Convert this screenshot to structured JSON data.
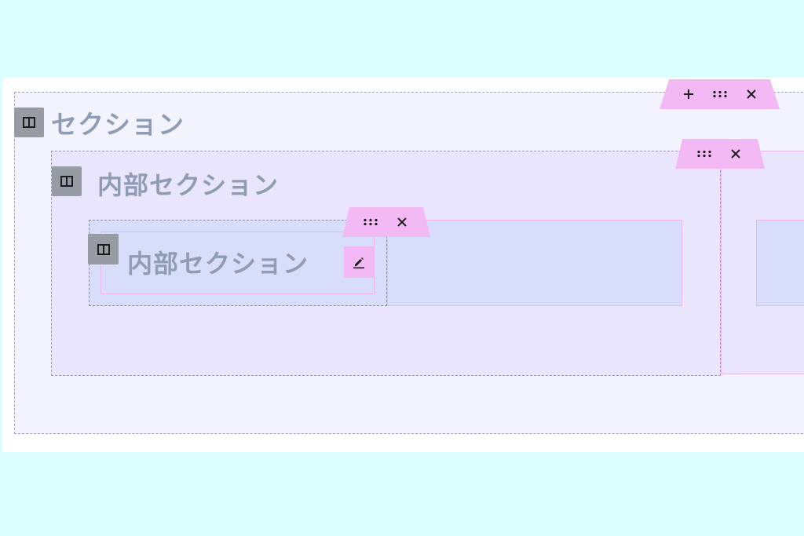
{
  "sections": {
    "outer": {
      "heading": "セクション"
    },
    "inner1": {
      "heading": "内部セクション"
    },
    "inner2": {
      "heading": "内部セクション"
    }
  },
  "icons": {
    "section_type": "columns-icon",
    "add": "plus-icon",
    "drag": "drag-handle-icon",
    "remove": "close-icon",
    "edit": "pencil-icon"
  },
  "colors": {
    "page_background": "#dcfefd",
    "toolbar_accent": "#f2b9f5",
    "heading_text": "#8e9db5",
    "badge": "#969ba4"
  }
}
